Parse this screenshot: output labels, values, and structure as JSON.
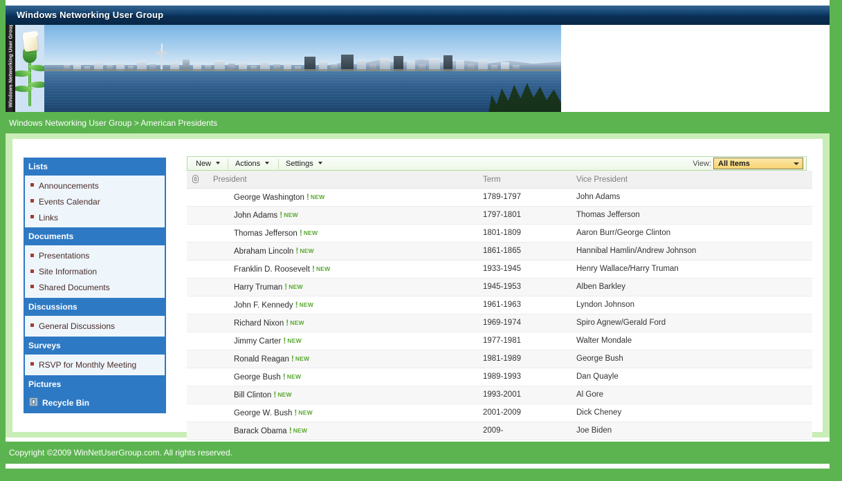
{
  "window": {
    "title": "Windows Networking User Group"
  },
  "banner": {
    "vertical_title": "Windows Networking User Group",
    "logo_icon": "flower-logo-icon",
    "photo_icon": "seattle-skyline-photo"
  },
  "breadcrumb": {
    "text": "Windows Networking User Group > American Presidents"
  },
  "sidebar": {
    "groups": [
      {
        "header": "Lists",
        "items": [
          {
            "label": "Announcements"
          },
          {
            "label": "Events Calendar"
          },
          {
            "label": "Links"
          }
        ]
      },
      {
        "header": "Documents",
        "items": [
          {
            "label": "Presentations"
          },
          {
            "label": "Site Information"
          },
          {
            "label": "Shared Documents"
          }
        ]
      },
      {
        "header": "Discussions",
        "items": [
          {
            "label": "General Discussions"
          }
        ]
      },
      {
        "header": "Surveys",
        "items": [
          {
            "label": "RSVP for Monthly Meeting"
          }
        ]
      },
      {
        "header": "Pictures",
        "items": []
      }
    ],
    "recycle_bin": {
      "label": "Recycle Bin",
      "icon": "recycle-bin-icon"
    }
  },
  "toolbar": {
    "new_label": "New",
    "actions_label": "Actions",
    "settings_label": "Settings",
    "view_label": "View:",
    "view_selected": "All Items",
    "view_options": [
      "All Items"
    ]
  },
  "list": {
    "columns": {
      "attachment": "",
      "president": "President",
      "term": "Term",
      "vice_president": "Vice President"
    },
    "new_badge_bang": "!",
    "new_badge_text": "NEW",
    "rows": [
      {
        "president": "George Washington",
        "term": "1789-1797",
        "vice_president": "John Adams"
      },
      {
        "president": "John Adams",
        "term": "1797-1801",
        "vice_president": "Thomas Jefferson"
      },
      {
        "president": "Thomas Jefferson",
        "term": "1801-1809",
        "vice_president": "Aaron Burr/George Clinton"
      },
      {
        "president": "Abraham Lincoln",
        "term": "1861-1865",
        "vice_president": "Hannibal Hamlin/Andrew Johnson"
      },
      {
        "president": "Franklin D. Roosevelt",
        "term": "1933-1945",
        "vice_president": "Henry Wallace/Harry Truman"
      },
      {
        "president": "Harry Truman",
        "term": "1945-1953",
        "vice_president": "Alben Barkley"
      },
      {
        "president": "John F. Kennedy",
        "term": "1961-1963",
        "vice_president": "Lyndon Johnson"
      },
      {
        "president": "Richard Nixon",
        "term": "1969-1974",
        "vice_president": "Spiro Agnew/Gerald Ford"
      },
      {
        "president": "Jimmy Carter",
        "term": "1977-1981",
        "vice_president": "Walter Mondale"
      },
      {
        "president": "Ronald Reagan",
        "term": "1981-1989",
        "vice_president": "George Bush"
      },
      {
        "president": "George Bush",
        "term": "1989-1993",
        "vice_president": "Dan Quayle"
      },
      {
        "president": "Bill Clinton",
        "term": "1993-2001",
        "vice_president": "Al Gore"
      },
      {
        "president": "George W. Bush",
        "term": "2001-2009",
        "vice_president": "Dick Cheney"
      },
      {
        "president": "Barack Obama",
        "term": "2009-",
        "vice_president": "Joe Biden"
      }
    ]
  },
  "footer": {
    "text": "Copyright ©2009 WinNetUserGroup.com. All rights reserved."
  },
  "colors": {
    "title_bar": "#0d3c68",
    "green_accent": "#5cb450",
    "panel_green": "#c9edb6",
    "sidebar_blue": "#2e79c4",
    "sidebar_panel": "#eef6fc",
    "view_gold": "#f7d271",
    "new_badge_green": "#5aa832"
  }
}
